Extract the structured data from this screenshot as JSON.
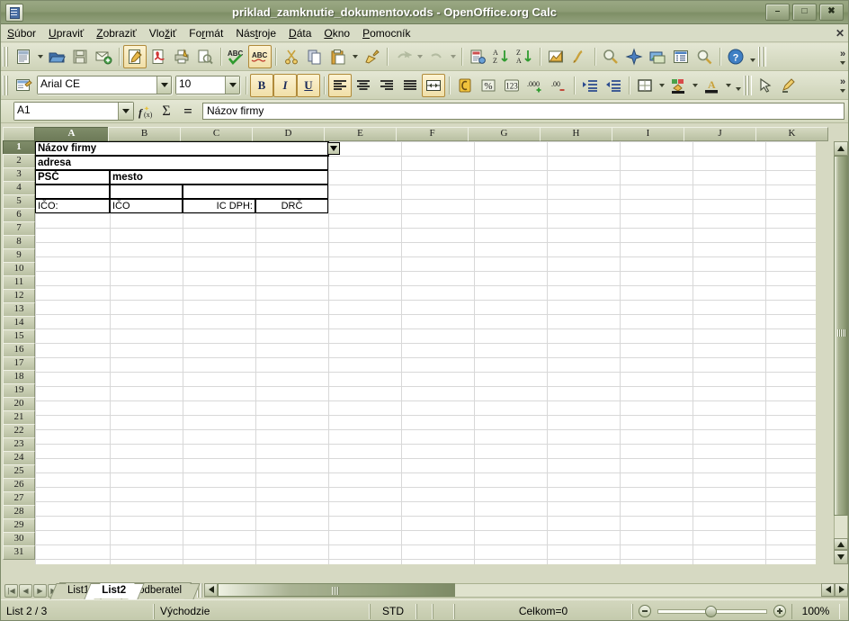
{
  "window": {
    "title": "priklad_zamknutie_dokumentov.ods - OpenOffice.org Calc",
    "app_icon": "calc-document-icon",
    "buttons": {
      "minimize": "–",
      "maximize": "□",
      "close": "✖"
    }
  },
  "menubar": {
    "items": [
      "Súbor",
      "Upraviť",
      "Zobraziť",
      "Vložiť",
      "Formát",
      "Nástroje",
      "Dáta",
      "Okno",
      "Pomocník"
    ],
    "close_document": "✕"
  },
  "toolbars": {
    "standard": {
      "items": [
        {
          "name": "new-document-icon",
          "label": "Nový"
        },
        {
          "name": "new-document-dropdown",
          "label": "Nový (rozbaliť)"
        },
        {
          "name": "open-document-icon",
          "label": "Otvoriť"
        },
        {
          "name": "save-document-icon",
          "label": "Uložiť"
        },
        {
          "name": "send-document-email-icon",
          "label": "Dokument ako e-mail"
        },
        {
          "name": "edit-file-icon",
          "label": "Upraviť súbor"
        },
        {
          "name": "export-pdf-icon",
          "label": "Exportovať priamo ako PDF"
        },
        {
          "name": "print-file-icon",
          "label": "Tlačiť súbor priamo"
        },
        {
          "name": "print-preview-icon",
          "label": "Náhľad strany"
        },
        {
          "name": "spellcheck-icon",
          "label": "Kontrola pravopisu"
        },
        {
          "name": "autospellcheck-icon",
          "label": "Automatická kontrola pravopisu"
        },
        {
          "name": "cut-icon",
          "label": "Vystrihnúť"
        },
        {
          "name": "copy-icon",
          "label": "Kopírovať"
        },
        {
          "name": "paste-icon",
          "label": "Vložiť"
        },
        {
          "name": "paste-dropdown",
          "label": "Vložiť (rozbaliť)"
        },
        {
          "name": "clone-formatting-icon",
          "label": "Štetec na formát"
        },
        {
          "name": "undo-icon",
          "label": "Späť"
        },
        {
          "name": "undo-dropdown",
          "label": "Späť (rozbaliť)"
        },
        {
          "name": "redo-icon",
          "label": "Znovu"
        },
        {
          "name": "redo-dropdown",
          "label": "Znovu (rozbaliť)"
        },
        {
          "name": "hyperlink-icon",
          "label": "Hypertextový odkaz"
        },
        {
          "name": "sort-ascending-icon",
          "label": "Zoradiť vzostupne"
        },
        {
          "name": "sort-descending-icon",
          "label": "Zoradiť zostupne"
        },
        {
          "name": "chart-icon",
          "label": "Graf"
        },
        {
          "name": "draw-functions-icon",
          "label": "Zobraziť funkcie kreslenia"
        },
        {
          "name": "find-replace-icon",
          "label": "Nájsť a nahradiť"
        },
        {
          "name": "navigator-icon",
          "label": "Navigátor"
        },
        {
          "name": "gallery-icon",
          "label": "Galéria"
        },
        {
          "name": "data-sources-icon",
          "label": "Zdroje dát"
        },
        {
          "name": "zoom-icon",
          "label": "Lupa"
        },
        {
          "name": "help-icon",
          "label": "Pomocník OpenOffice.org"
        }
      ],
      "overflow": "»"
    },
    "formatting": {
      "styles_icon": "styles-and-formatting-icon",
      "font_name": "Arial CE",
      "font_size": "10",
      "bold_label": "B",
      "italic_label": "I",
      "underline_label": "U",
      "items": [
        {
          "name": "align-left-icon",
          "label": "Zarovnať vľavo",
          "active": true
        },
        {
          "name": "align-center-icon",
          "label": "Na stred"
        },
        {
          "name": "align-right-icon",
          "label": "Zarovnať vpravo"
        },
        {
          "name": "align-justified-icon",
          "label": "Do bloku"
        },
        {
          "name": "merge-cells-icon",
          "label": "Zlúčiť bunky",
          "active": true
        },
        {
          "name": "currency-format-icon",
          "label": "Formát meny"
        },
        {
          "name": "percent-format-icon",
          "label": "Formát percenta"
        },
        {
          "name": "number-format-icon",
          "label": "Formát čísla"
        },
        {
          "name": "add-decimal-icon",
          "label": "Pridať desatinné miesto"
        },
        {
          "name": "delete-decimal-icon",
          "label": "Odstrániť desatinné miesto"
        },
        {
          "name": "decrease-indent-icon",
          "label": "Zmenšiť odsadenie"
        },
        {
          "name": "increase-indent-icon",
          "label": "Zväčšiť odsadenie"
        },
        {
          "name": "borders-icon",
          "label": "Orámovanie"
        },
        {
          "name": "borders-dropdown",
          "label": "Orámovanie (rozbaliť)"
        },
        {
          "name": "background-color-icon",
          "label": "Farba pozadia"
        },
        {
          "name": "background-color-dropdown",
          "label": "Farba pozadia (rozbaliť)"
        },
        {
          "name": "font-color-icon",
          "label": "Farba písma"
        },
        {
          "name": "font-color-dropdown",
          "label": "Farba písma (rozbaliť)"
        },
        {
          "name": "select-tool-icon",
          "label": "Výber"
        },
        {
          "name": "highlighting-icon",
          "label": "Zvýraznenie"
        }
      ],
      "overflow": "»"
    }
  },
  "formulabar": {
    "name_box": "A1",
    "function_wizard_icon": "function-wizard-icon",
    "sum_icon": "sum-icon",
    "equals_icon": "equals-icon",
    "input_line": "Názov firmy"
  },
  "grid": {
    "columns": [
      "A",
      "B",
      "C",
      "D",
      "E",
      "F",
      "G",
      "H",
      "I",
      "J",
      "K"
    ],
    "selected_column": "A",
    "rows": [
      1,
      2,
      3,
      4,
      5,
      6,
      7,
      8,
      9,
      10,
      11,
      12,
      13,
      14,
      15,
      16,
      17,
      18,
      19,
      20,
      21,
      22,
      23,
      24,
      25,
      26,
      27,
      28,
      29,
      30,
      31
    ],
    "selected_row": 1,
    "active_cell": "A1",
    "cells": [
      {
        "ref": "A1",
        "text": "Názov firmy",
        "bold": true,
        "align": "left",
        "merge": "A1:D1",
        "bordered": true
      },
      {
        "ref": "A2",
        "text": "adresa",
        "bold": true,
        "align": "left",
        "merge": "A2:D2",
        "bordered": true
      },
      {
        "ref": "A3",
        "text": "PSČ",
        "bold": true,
        "align": "left",
        "bordered": true
      },
      {
        "ref": "B3",
        "text": "mesto",
        "bold": true,
        "align": "left",
        "merge": "B3:D3",
        "bordered": true
      },
      {
        "ref": "A4",
        "text": "",
        "bold": false,
        "align": "left",
        "bordered": true
      },
      {
        "ref": "B4",
        "text": "",
        "bold": false,
        "align": "left",
        "bordered": true
      },
      {
        "ref": "C4",
        "text": "",
        "bold": false,
        "align": "left",
        "merge": "C4:D4",
        "bordered": true
      },
      {
        "ref": "A5",
        "text": "IČO:",
        "bold": false,
        "align": "left",
        "bordered": true
      },
      {
        "ref": "B5",
        "text": "IČO",
        "bold": false,
        "align": "left",
        "bordered": true
      },
      {
        "ref": "C5",
        "text": "IC DPH:",
        "bold": false,
        "align": "right",
        "bordered": true
      },
      {
        "ref": "D5",
        "text": "DRČ",
        "bold": false,
        "align": "center",
        "bordered": true
      }
    ],
    "dropdown_marker": "merged-cell-dropdown-icon"
  },
  "sheettabs": {
    "nav_first": "|◀",
    "nav_prev": "◀",
    "nav_next": "▶",
    "nav_last": "▶|",
    "tabs": [
      {
        "label": "List1",
        "active": false
      },
      {
        "label": "List2",
        "active": true
      },
      {
        "label": "odberatel",
        "active": false
      }
    ]
  },
  "statusbar": {
    "sheet_position": "List 2 / 3",
    "page_style": "Východzie",
    "selection_mode": "STD",
    "modified": "",
    "signature": "",
    "total": "Celkom=0",
    "zoom_out_icon": "zoom-out-icon",
    "zoom_in_icon": "zoom-in-icon",
    "zoom_level": "100%"
  },
  "colors": {
    "titlebar": "#8d9c75",
    "chrome": "#d6d9c2",
    "header": "#c5cbae",
    "header_selected": "#76836180",
    "grid_line": "#d8d8d8",
    "cell_border": "#000000"
  }
}
